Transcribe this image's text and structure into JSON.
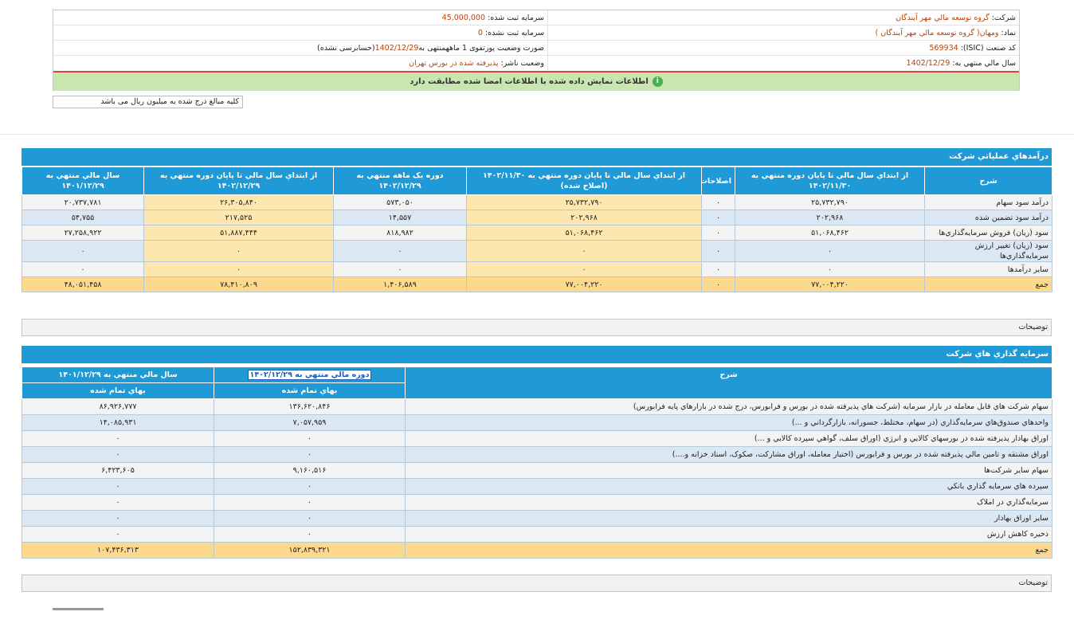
{
  "header": {
    "company_label": "شرکت:",
    "company_value": "گروه توسعه مالي مهر آيندگان",
    "capital_registered_label": "سرمايه ثبت شده:",
    "capital_registered_value": "45,000,000",
    "symbol_label": "نماد:",
    "symbol_value": "ومهان( گروه توسعه مالي مهر آيندگان )",
    "capital_unregistered_label": "سرمايه ثبت نشده:",
    "capital_unregistered_value": "0",
    "isic_label": "کد صنعت (ISIC):",
    "isic_value": "569934",
    "portfolio_status_prefix": "صورت وضعیت پورتفوی 1 ماهه",
    "portfolio_status_mid": "منتهی به",
    "portfolio_status_date": "1402/12/29",
    "portfolio_status_suffix": "(حسابرسی نشده)",
    "fiscal_year_label": "سال مالي منتهي به:",
    "fiscal_year_value": "1402/12/29",
    "publisher_status_label": "وضعيت ناشر:",
    "publisher_status_value": "پذيرفته شده در بورس تهران",
    "alert_text": "اطلاعات نمایش داده شده با اطلاعات امضا شده مطابقت دارد",
    "alert_icon": "info-icon",
    "unit_note": "کلیه مبالغ درج شده به میلیون ریال می باشد"
  },
  "revenue": {
    "title": "درآمدهاي عملياتي شرکت",
    "columns": [
      "شرح",
      "از ابتداي سال مالي تا پايان دوره منتهي به ۱۴۰۲/۱۱/۳۰",
      "اصلاحات",
      "از ابتداي سال مالي تا پايان دوره منتهي به ۱۴۰۲/۱۱/۳۰ (اصلاح شده)",
      "دوره يک ماهه منتهي به ۱۴۰۲/۱۲/۲۹",
      "از ابتداي سال مالي تا پايان دوره منتهي به ۱۴۰۲/۱۲/۲۹",
      "سال مالي منتهي به ۱۴۰۱/۱۲/۲۹"
    ],
    "rows": [
      [
        "درآمد سود سهام",
        "۲۵,۷۳۲,۷۹۰",
        "۰",
        "۲۵,۷۳۲,۷۹۰",
        "۵۷۳,۰۵۰",
        "۲۶,۳۰۵,۸۴۰",
        "۲۰,۷۳۷,۷۸۱"
      ],
      [
        "درآمد سود تضمين شده",
        "۲۰۲,۹۶۸",
        "۰",
        "۲۰۲,۹۶۸",
        "۱۴,۵۵۷",
        "۲۱۷,۵۲۵",
        "۵۴,۷۵۵"
      ],
      [
        "سود (زيان) فروش سرمايه‌گذاري‌ها",
        "۵۱,۰۶۸,۴۶۲",
        "۰",
        "۵۱,۰۶۸,۴۶۲",
        "۸۱۸,۹۸۲",
        "۵۱,۸۸۷,۴۴۴",
        "۲۷,۲۵۸,۹۲۲"
      ],
      [
        "سود (زيان) تغيير ارزش سرمايه‌گذاري‌ها",
        "۰",
        "۰",
        "۰",
        "۰",
        "۰",
        "۰"
      ],
      [
        "ساير درآمدها",
        "۰",
        "۰",
        "۰",
        "۰",
        "۰",
        "۰"
      ],
      [
        "جمع",
        "۷۷,۰۰۴,۲۲۰",
        "۰",
        "۷۷,۰۰۴,۲۲۰",
        "۱,۴۰۶,۵۸۹",
        "۷۸,۴۱۰,۸۰۹",
        "۴۸,۰۵۱,۴۵۸"
      ]
    ],
    "notes_label": "توضيحات"
  },
  "investments": {
    "title": "سرمايه گذاري هاي شرکت",
    "col_desc": "شرح",
    "col_current_period": "دوره مالي منتهي به ۱۴۰۲/۱۲/۲۹",
    "col_prev_year": "سال مالي منتهي به ۱۴۰۱/۱۲/۲۹",
    "sub_current": "بهاي تمام شده",
    "sub_prev": "بهاي تمام شده",
    "rows": [
      [
        "سهام شرکت هاي قابل معامله در بازار سرمايه (شرکت هاي پذيرفته شده در بورس و فرابورس، درج شده در بازارهاي پايه فرابورس)",
        "۱۳۶,۶۲۰,۸۴۶",
        "۸۶,۹۲۶,۷۷۷"
      ],
      [
        "واحدهاي صندوق‌هاي سرمايه‌گذاري (در سهام، مختلط، جسورانه، بازارگرداني و ...)",
        "۷,۰۵۷,۹۵۹",
        "۱۴,۰۸۵,۹۳۱"
      ],
      [
        "اوراق بهادار پذيرفته شده در بورسهاي کالايي و انرژي (اوراق سلف، گواهي سپرده کالايي و ...)",
        "۰",
        "۰"
      ],
      [
        "اوراق مشتقه و تامين مالي پذيرفته شده در بورس و فرابورس (اختيار معامله، اوراق مشارکت، صکوک، اسناد خزانه و....)",
        "۰",
        "۰"
      ],
      [
        "سهام ساير شرکت‌ها",
        "۹,۱۶۰,۵۱۶",
        "۶,۴۲۳,۶۰۵"
      ],
      [
        "سپرده هاي سرمايه گذاري بانکي",
        "۰",
        "۰"
      ],
      [
        "سرمايه‌گذاري در املاک",
        "۰",
        "۰"
      ],
      [
        "ساير اوراق بهادار",
        "۰",
        "۰"
      ],
      [
        "ذخيره کاهش ارزش",
        "۰",
        "۰"
      ],
      [
        "جمع",
        "۱۵۲,۸۳۹,۳۲۱",
        "۱۰۷,۴۳۶,۳۱۳"
      ]
    ],
    "notes_label": "توضيحات"
  }
}
